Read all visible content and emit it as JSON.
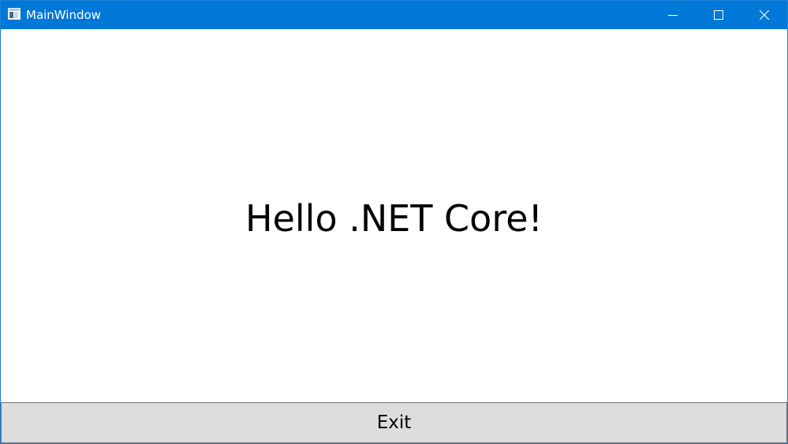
{
  "window": {
    "title": "MainWindow",
    "title_bar_color": "#0078d7",
    "icons": {
      "app": "app-window-icon",
      "minimize": "minimize-icon",
      "maximize": "maximize-icon",
      "close": "close-icon"
    }
  },
  "main": {
    "message": "Hello .NET Core!"
  },
  "footer": {
    "exit_label": "Exit",
    "button_color": "#dddddd"
  }
}
